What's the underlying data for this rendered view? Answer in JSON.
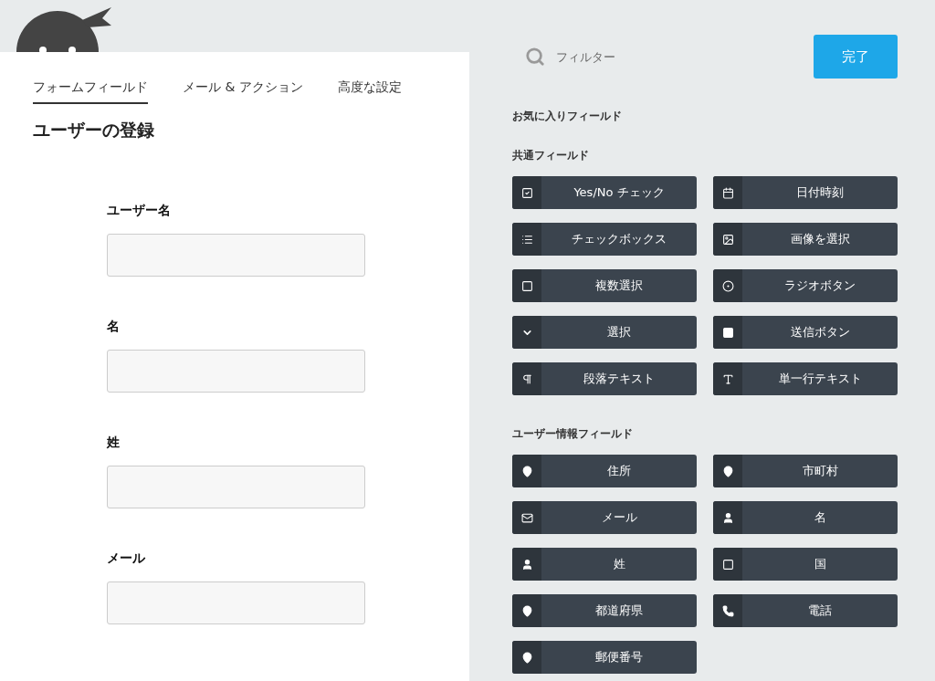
{
  "tabs": [
    {
      "label": "フォームフィールド",
      "selected": true
    },
    {
      "label": "メール & アクション",
      "selected": false
    },
    {
      "label": "高度な設定",
      "selected": false
    }
  ],
  "form": {
    "title": "ユーザーの登録",
    "fields": [
      {
        "label": "ユーザー名"
      },
      {
        "label": "名"
      },
      {
        "label": "姓"
      },
      {
        "label": "メール"
      }
    ]
  },
  "filter": {
    "placeholder": "フィルター"
  },
  "done_button": "完了",
  "favorites": {
    "title": "お気に入りフィールド"
  },
  "sections": [
    {
      "title": "共通フィールド",
      "items": [
        {
          "label": "Yes/No チェック",
          "kind": "checkbox"
        },
        {
          "label": "日付時刻",
          "kind": "calendar"
        },
        {
          "label": "チェックボックス",
          "kind": "list"
        },
        {
          "label": "画像を選択",
          "kind": "image"
        },
        {
          "label": "複数選択",
          "kind": "square"
        },
        {
          "label": "ラジオボタン",
          "kind": "radio"
        },
        {
          "label": "選択",
          "kind": "chevron"
        },
        {
          "label": "送信ボタン",
          "kind": "filled-square"
        },
        {
          "label": "段落テキスト",
          "kind": "pilcrow"
        },
        {
          "label": "単一行テキスト",
          "kind": "text"
        }
      ]
    },
    {
      "title": "ユーザー情報フィールド",
      "items": [
        {
          "label": "住所",
          "kind": "pin"
        },
        {
          "label": "市町村",
          "kind": "pin"
        },
        {
          "label": "メール",
          "kind": "mail"
        },
        {
          "label": "名",
          "kind": "user"
        },
        {
          "label": "姓",
          "kind": "user"
        },
        {
          "label": "国",
          "kind": "square"
        },
        {
          "label": "都道府県",
          "kind": "pin"
        },
        {
          "label": "電話",
          "kind": "phone"
        },
        {
          "label": "郵便番号",
          "kind": "pin"
        }
      ]
    }
  ]
}
